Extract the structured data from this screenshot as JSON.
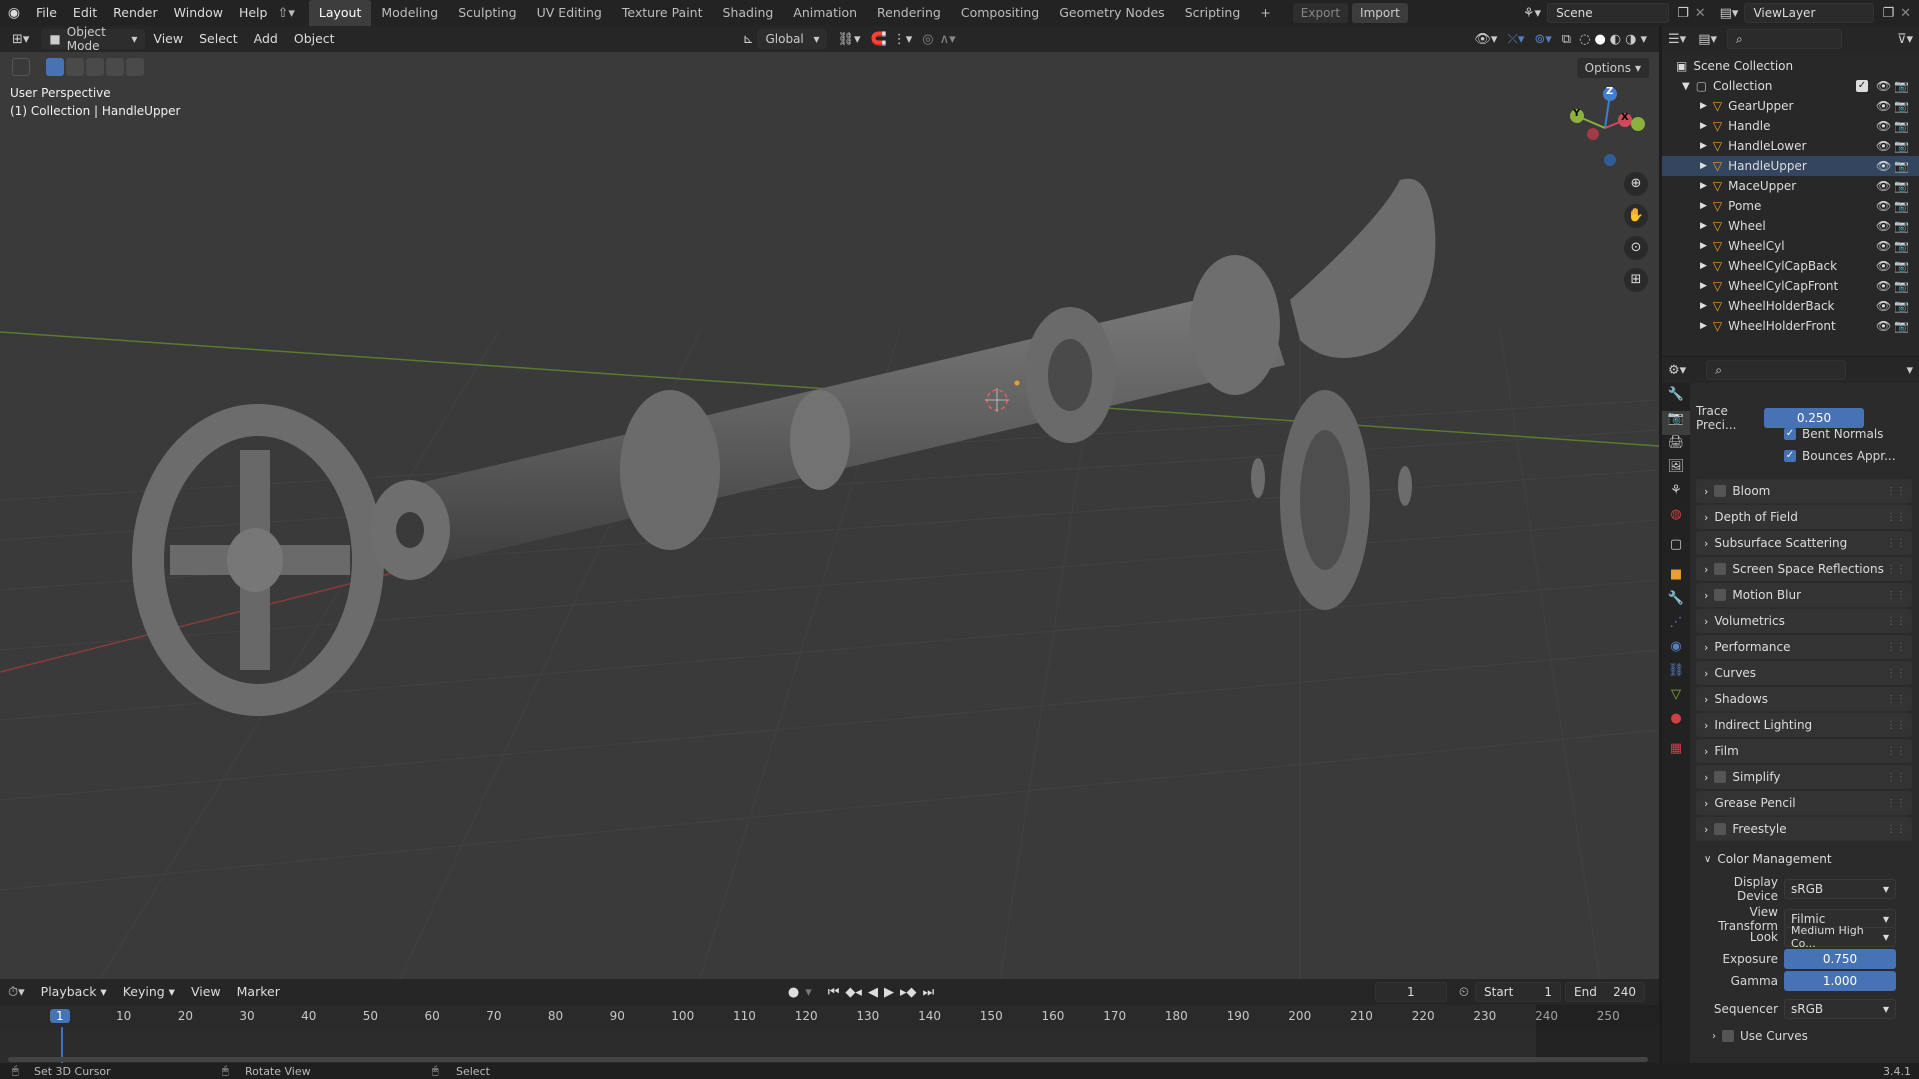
{
  "menu": {
    "items": [
      "File",
      "Edit",
      "Render",
      "Window",
      "Help"
    ]
  },
  "workspaces": {
    "tabs": [
      "Layout",
      "Modeling",
      "Sculpting",
      "UV Editing",
      "Texture Paint",
      "Shading",
      "Animation",
      "Rendering",
      "Compositing",
      "Geometry Nodes",
      "Scripting"
    ],
    "active": "Layout",
    "add": "+"
  },
  "io": {
    "export": "Export",
    "import": "Import"
  },
  "scene": {
    "name": "Scene",
    "view_layer": "ViewLayer"
  },
  "viewport_header": {
    "mode": "Object Mode",
    "menus": [
      "View",
      "Select",
      "Add",
      "Object"
    ],
    "transform": "Global",
    "options": "Options"
  },
  "overlay": {
    "perspective": "User Perspective",
    "collection": "(1) Collection | HandleUpper"
  },
  "gizmo": {
    "z": "Z",
    "y": "Y",
    "x": "X"
  },
  "outliner": {
    "root": "Scene Collection",
    "collection": "Collection",
    "objects": [
      "GearUpper",
      "Handle",
      "HandleLower",
      "HandleUpper",
      "MaceUpper",
      "Pome",
      "Wheel",
      "WheelCyl",
      "WheelCylCapBack",
      "WheelCylCapFront",
      "WheelHolderBack",
      "WheelHolderFront"
    ]
  },
  "properties": {
    "trace_label": "Trace Preci...",
    "trace_value": "0.250",
    "bent_normals": "Bent Normals",
    "bounces": "Bounces Appr...",
    "panels": [
      "Bloom",
      "Depth of Field",
      "Subsurface Scattering",
      "Screen Space Reflections",
      "Motion Blur",
      "Volumetrics",
      "Performance",
      "Curves",
      "Shadows",
      "Indirect Lighting",
      "Film",
      "Simplify",
      "Grease Pencil",
      "Freestyle"
    ],
    "panels_checkbox": [
      "Bloom",
      "Screen Space Reflections",
      "Motion Blur",
      "Simplify",
      "Freestyle"
    ],
    "color_mgmt": {
      "title": "Color Management",
      "display_device_label": "Display Device",
      "display_device": "sRGB",
      "view_transform_label": "View Transform",
      "view_transform": "Filmic",
      "look_label": "Look",
      "look": "Medium High Co...",
      "exposure_label": "Exposure",
      "exposure": "0.750",
      "gamma_label": "Gamma",
      "gamma": "1.000",
      "sequencer_label": "Sequencer",
      "sequencer": "sRGB",
      "use_curves": "Use Curves"
    }
  },
  "timeline": {
    "menus": [
      "Playback",
      "Keying",
      "View",
      "Marker"
    ],
    "current_frame": "1",
    "start_label": "Start",
    "start": "1",
    "end_label": "End",
    "end": "240",
    "ticks": [
      "1",
      "10",
      "20",
      "30",
      "40",
      "50",
      "60",
      "70",
      "80",
      "90",
      "100",
      "110",
      "120",
      "130",
      "140",
      "150",
      "160",
      "170",
      "180",
      "190",
      "200",
      "210",
      "220",
      "230",
      "240",
      "250"
    ]
  },
  "status": {
    "left": "Set 3D Cursor",
    "middle": "Rotate View",
    "right": "Select",
    "version": "3.4.1"
  }
}
